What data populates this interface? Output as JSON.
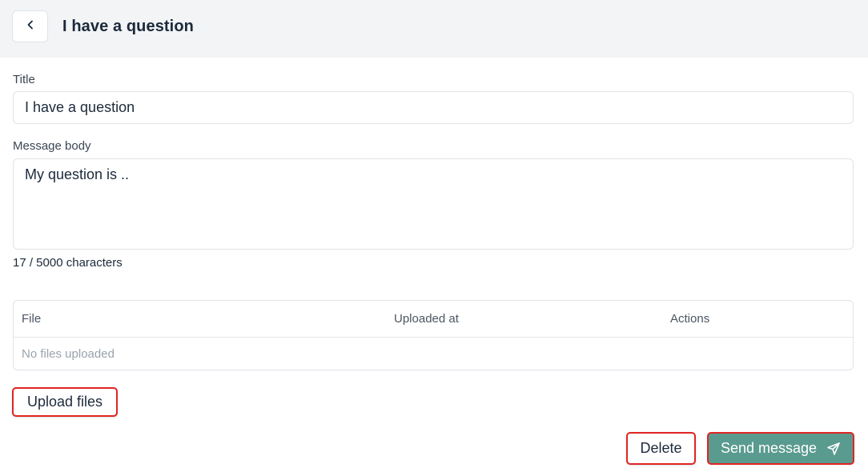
{
  "header": {
    "back_icon": "chevron-left-icon",
    "title": "I have a question"
  },
  "form": {
    "title_label": "Title",
    "title_value": "I have a question",
    "body_label": "Message body",
    "body_value": "My question is ..",
    "char_count": "17 / 5000 characters"
  },
  "files_table": {
    "columns": [
      "File",
      "Uploaded at",
      "Actions"
    ],
    "empty_text": "No files uploaded"
  },
  "actions": {
    "upload_label": "Upload files",
    "delete_label": "Delete",
    "send_label": "Send message",
    "send_icon": "send-icon"
  },
  "colors": {
    "header_bg": "#f3f4f6",
    "primary": "#5a9b8f",
    "highlight": "#e02424"
  }
}
